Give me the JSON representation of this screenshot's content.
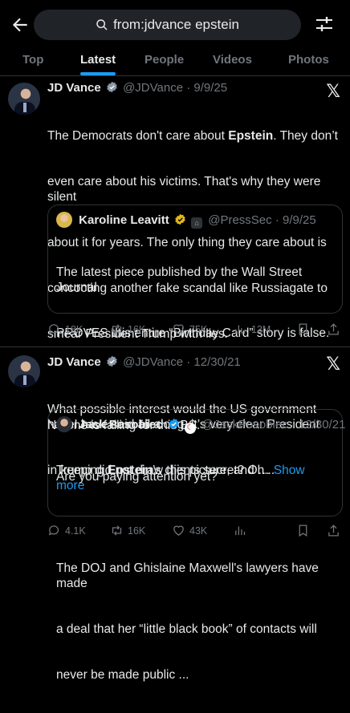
{
  "search": {
    "query": "from:jdvance epstein"
  },
  "tabs": [
    "Top",
    "Latest",
    "People",
    "Videos",
    "Photos"
  ],
  "tweets": [
    {
      "name": "JD Vance",
      "handle": "@JDVance",
      "date": "9/9/25",
      "body_lines": [
        [
          "The Democrats don't care about ",
          "Epstein",
          ". They don’t"
        ],
        [
          "even care about his victims. That's why they were silent"
        ],
        [
          "about it for years. The only thing they care about is"
        ],
        [
          "concocting another fake scandal like Russiagate to"
        ],
        [
          "smear President Trump with lies."
        ],
        [
          ""
        ],
        [
          "No one is falling for this BS."
        ]
      ],
      "quote": {
        "name": "Karoline Leavitt",
        "handle": "@PressSec",
        "date": "9/9/25",
        "lines": [
          "The latest piece published by the Wall Street Journal",
          "PROVES this entire “Birthday Card” story is false.",
          "",
          "As I have said all along, it’s very clear President",
          "Trump did not draw this picture, and … "
        ],
        "show_more": "Show more"
      },
      "stats": {
        "replies": "18K",
        "reposts": "16K",
        "likes": "75K",
        "views": "13M"
      }
    },
    {
      "name": "JD Vance",
      "handle": "@JDVance",
      "date": "12/30/21",
      "body_lines": [
        [
          "What possible interest would the US government have"
        ],
        [
          "in keeping ",
          "Epstein",
          "’s clients secret? Oh..."
        ]
      ],
      "quote": {
        "name": "Jack Posobiec",
        "handle": "@JackPosobiec",
        "date": "12/30/21",
        "lines": [
          "Are you paying attention yet?",
          "",
          "The DOJ and Ghislaine Maxwell's lawyers have made",
          "a deal that her “little black book” of contacts will",
          "never be made public ..."
        ]
      },
      "stats": {
        "replies": "4.1K",
        "reposts": "16K",
        "likes": "43K",
        "views": ""
      }
    }
  ],
  "colors": {
    "accent": "#1d9bf0",
    "background": "#000000",
    "muted": "#71767b",
    "verified_gold": "#e2b719",
    "verified_blue": "#1d9bf0"
  }
}
